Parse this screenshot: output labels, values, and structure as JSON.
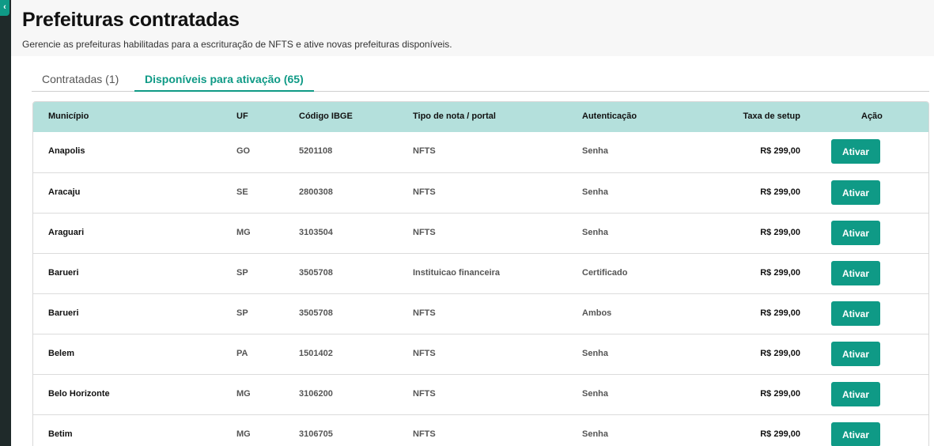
{
  "header": {
    "title": "Prefeituras contratadas",
    "subtitle": "Gerencie as prefeituras habilitadas para a escrituração de NFTS e ative novas prefeituras disponíveis."
  },
  "tabs": [
    {
      "label": "Contratadas (1)",
      "active": false
    },
    {
      "label": "Disponíveis para ativação (65)",
      "active": true
    }
  ],
  "table": {
    "columns": {
      "municipio": "Município",
      "uf": "UF",
      "ibge": "Código IBGE",
      "tipo": "Tipo de nota / portal",
      "auth": "Autenticação",
      "taxa": "Taxa de setup",
      "acao": "Ação"
    },
    "action_label": "Ativar",
    "rows": [
      {
        "municipio": "Anapolis",
        "uf": "GO",
        "ibge": "5201108",
        "tipo": "NFTS",
        "auth": "Senha",
        "taxa": "R$ 299,00"
      },
      {
        "municipio": "Aracaju",
        "uf": "SE",
        "ibge": "2800308",
        "tipo": "NFTS",
        "auth": "Senha",
        "taxa": "R$ 299,00"
      },
      {
        "municipio": "Araguari",
        "uf": "MG",
        "ibge": "3103504",
        "tipo": "NFTS",
        "auth": "Senha",
        "taxa": "R$ 299,00"
      },
      {
        "municipio": "Barueri",
        "uf": "SP",
        "ibge": "3505708",
        "tipo": "Instituicao financeira",
        "auth": "Certificado",
        "taxa": "R$ 299,00"
      },
      {
        "municipio": "Barueri",
        "uf": "SP",
        "ibge": "3505708",
        "tipo": "NFTS",
        "auth": "Ambos",
        "taxa": "R$ 299,00"
      },
      {
        "municipio": "Belem",
        "uf": "PA",
        "ibge": "1501402",
        "tipo": "NFTS",
        "auth": "Senha",
        "taxa": "R$ 299,00"
      },
      {
        "municipio": "Belo Horizonte",
        "uf": "MG",
        "ibge": "3106200",
        "tipo": "NFTS",
        "auth": "Senha",
        "taxa": "R$ 299,00"
      },
      {
        "municipio": "Betim",
        "uf": "MG",
        "ibge": "3106705",
        "tipo": "NFTS",
        "auth": "Senha",
        "taxa": "R$ 299,00"
      }
    ]
  },
  "icons": {
    "collapse": "chevron-left-icon"
  },
  "colors": {
    "accent": "#0f9a86",
    "header_bg": "#b4e0dc"
  }
}
